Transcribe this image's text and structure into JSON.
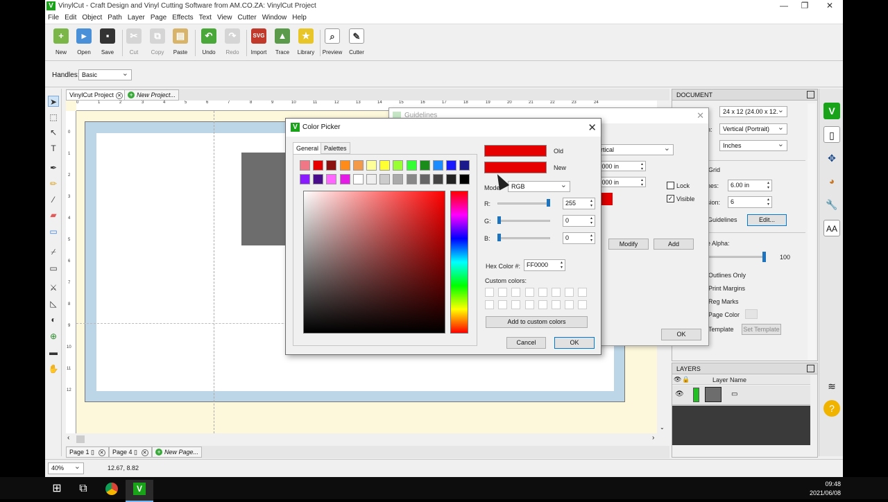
{
  "window": {
    "title": "VinylCut - Craft Design and Vinyl Cutting Software from AM.CO.ZA: VinylCut Project",
    "logo": "V",
    "controls": [
      "—",
      "❐",
      "✕"
    ]
  },
  "menu": [
    "File",
    "Edit",
    "Object",
    "Path",
    "Layer",
    "Page",
    "Effects",
    "Text",
    "View",
    "Cutter",
    "Window",
    "Help"
  ],
  "toolbar": {
    "new": "New",
    "open": "Open",
    "save": "Save",
    "cut": "Cut",
    "copy": "Copy",
    "paste": "Paste",
    "undo": "Undo",
    "redo": "Redo",
    "import": "Import",
    "trace": "Trace",
    "library": "Library",
    "preview": "Preview",
    "cutter": "Cutter"
  },
  "handles": {
    "label": "Handles:",
    "value": "Basic"
  },
  "doc_tabs": {
    "active": "VinylCut Project",
    "new": "New Project..."
  },
  "page_tabs": {
    "page1": "Page 1",
    "page4": "Page 4",
    "new": "New Page..."
  },
  "status": {
    "zoom": "40%",
    "coords": "12.67, 8.82"
  },
  "ruler": {
    "h": [
      "0",
      "1",
      "2",
      "3",
      "4",
      "5",
      "6",
      "7",
      "8",
      "9",
      "10",
      "11",
      "12",
      "13",
      "14",
      "15",
      "16",
      "17",
      "18",
      "19",
      "20",
      "21",
      "22",
      "23",
      "24"
    ],
    "v": [
      "0",
      "1",
      "2",
      "3",
      "4",
      "5",
      "6",
      "7",
      "8",
      "9",
      "10",
      "11",
      "12"
    ]
  },
  "document_panel": {
    "header": "DOCUMENT",
    "size": "24 x 12 (24.00 x 12.",
    "orientation_label": "n:",
    "orientation": "Vertical (Portrait)",
    "units": "Inches",
    "grid": "Grid",
    "lines_label": "nes:",
    "lines_value": "6.00 in",
    "division_label": "sion:",
    "division_value": "6",
    "guidelines": "Guidelines",
    "edit": "Edit...",
    "alpha_label": "e Alpha:",
    "alpha_value": "100",
    "outlines_only": "Outlines Only",
    "print_margins": "Print Margins",
    "reg_marks": "Reg Marks",
    "page_color": "Page Color",
    "template": "Template",
    "set_template": "Set Template"
  },
  "layers_panel": {
    "header": "LAYERS",
    "column": "Layer Name"
  },
  "guidelines_dialog": {
    "title": "Guidelines",
    "orientation": "rtical",
    "pos1": ".000 in",
    "pos2": ".000 in",
    "lock": "Lock",
    "visible": "Visible",
    "modify": "Modify",
    "add": "Add",
    "ok": "OK"
  },
  "color_picker": {
    "title": "Color Picker",
    "tab_general": "General",
    "tab_palettes": "Palettes",
    "old_label": "Old",
    "new_label": "New",
    "old_color": "#e60000",
    "new_color": "#e60000",
    "mode_label": "Mode",
    "mode_value": "RGB",
    "r_label": "R:",
    "g_label": "G:",
    "b_label": "B:",
    "r_value": "255",
    "g_value": "0",
    "b_value": "0",
    "hex_label": "Hex Color #:",
    "hex_value": "FF0000",
    "custom_label": "Custom colors:",
    "add_custom": "Add to custom colors",
    "cancel": "Cancel",
    "ok": "OK",
    "swatches_row1": [
      "#f07785",
      "#e60000",
      "#8b1010",
      "#ff8c1a",
      "#f39a4a",
      "#ffff99",
      "#ffff33",
      "#99ff33",
      "#33ff33",
      "#1a8c1a",
      "#1a8cff",
      "#1a1aff",
      "#1a1a8c"
    ],
    "swatches_row2": [
      "#8a1aff",
      "#4a0d8c",
      "#ff66ff",
      "#e61ae6",
      "#ffffff",
      "#eeeeee",
      "#cccccc",
      "#aaaaaa",
      "#888888",
      "#666666",
      "#444444",
      "#222222",
      "#000000"
    ]
  },
  "taskbar": {
    "time": "09:48",
    "date": "2021/06/08"
  }
}
